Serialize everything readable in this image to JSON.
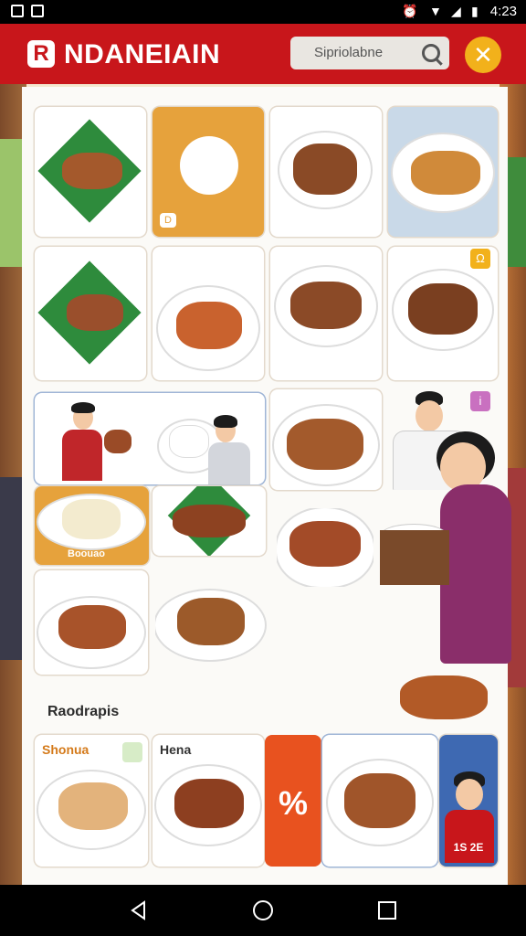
{
  "status_bar": {
    "time": "4:23"
  },
  "app": {
    "logo_letter": "R",
    "brand": "NDANEIAIN"
  },
  "search": {
    "placeholder": "Sipriolabne"
  },
  "close_symbol": "✕",
  "sections": {
    "section1_title": "Raodrapis"
  },
  "cards": {
    "rice_badge": "D",
    "noodle_badge": "Ω",
    "purple_badge": "i",
    "pasta_label": "Boouao",
    "shonua_title": "Shonua",
    "hena_title": "Hena",
    "percent_symbol": "%",
    "promo_price": "1S 2E"
  },
  "colors": {
    "brand_red": "#c8161b",
    "accent_yellow": "#f2b11b",
    "promo_orange": "#e8521f",
    "promo_blue": "#3e69b2"
  }
}
